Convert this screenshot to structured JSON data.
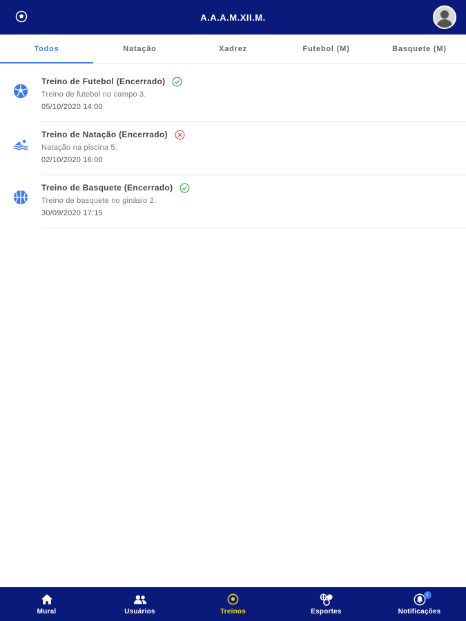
{
  "header": {
    "title": "A.A.A.M.XII.M.",
    "left_icon": "soccer-ball-icon",
    "avatar": "user-avatar"
  },
  "tabs": [
    {
      "label": "Todos",
      "active": true
    },
    {
      "label": "Natação",
      "active": false
    },
    {
      "label": "Xadrez",
      "active": false
    },
    {
      "label": "Futebol (M)",
      "active": false
    },
    {
      "label": "Basquete (M)",
      "active": false
    }
  ],
  "trainings": [
    {
      "title": "Treino de Futebol (Encerrado)",
      "description": "Treino de futebol no campo 3.",
      "datetime": "05/10/2020 14:00",
      "icon": "soccer-ball-icon",
      "status": "check-circle-icon",
      "status_color": "#2e9e3e"
    },
    {
      "title": "Treino de Natação (Encerrado)",
      "description": "Natação na piscina 5.",
      "datetime": "02/10/2020 16:00",
      "icon": "swimmer-icon",
      "status": "x-circle-icon",
      "status_color": "#e04848"
    },
    {
      "title": "Treino de Basquete (Encerrado)",
      "description": "Treino de basquete no ginásio 2.",
      "datetime": "30/09/2020 17:15",
      "icon": "basketball-icon",
      "status": "check-circle-icon",
      "status_color": "#2e9e3e"
    }
  ],
  "bottom_nav": [
    {
      "label": "Mural",
      "icon": "home-icon",
      "active": false
    },
    {
      "label": "Usuários",
      "icon": "users-icon",
      "active": false
    },
    {
      "label": "Treinos",
      "icon": "soccer-ball-icon",
      "active": true
    },
    {
      "label": "Esportes",
      "icon": "sports-icon",
      "active": false
    },
    {
      "label": "Notificações",
      "icon": "bell-icon",
      "active": false,
      "badge": "1"
    }
  ],
  "colors": {
    "primary": "#0a1a7a",
    "accent": "#3c7be8",
    "active_nav": "#f2d21b"
  }
}
